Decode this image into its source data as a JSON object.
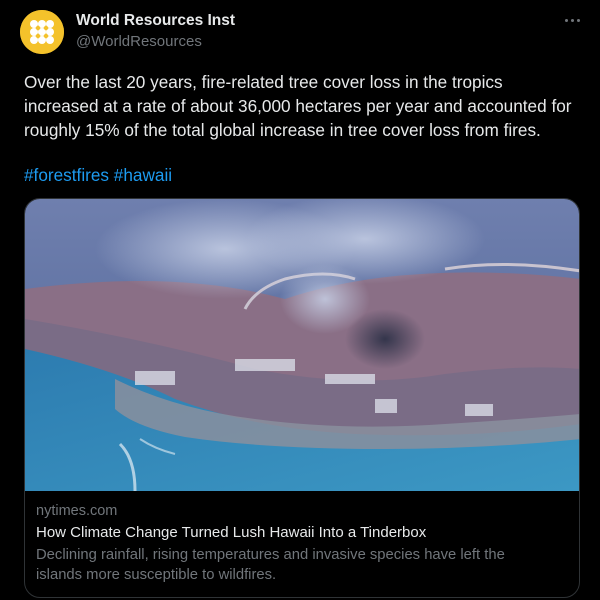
{
  "author": {
    "name": "World Resources Inst",
    "handle": "@WorldResources",
    "avatar_icon": "wri-logo-icon",
    "avatar_color": "#f4c22b"
  },
  "tweet": {
    "text": "Over the last 20 years, fire-related tree cover loss in the tropics\nincreased at a rate of about 36,000 hectares per year and accounted for\nroughly 15% of the total global increase in tree cover loss from fires.",
    "hashtags": [
      "#forestfires",
      "#hawaii"
    ]
  },
  "card": {
    "domain": "nytimes.com",
    "title": "How Climate Change Turned Lush Hawaii Into a Tinderbox",
    "description": "Declining rainfall, rising temperatures and invasive species have left the\nislands more susceptible to wildfires.",
    "image_icon": "aerial-photo-burning-town"
  },
  "colors": {
    "background": "#000000",
    "text": "#e7e9ea",
    "muted": "#71767b",
    "link": "#1d9bf0",
    "border": "#2f3336"
  },
  "icons": {
    "more": "more-horizontal-icon"
  }
}
